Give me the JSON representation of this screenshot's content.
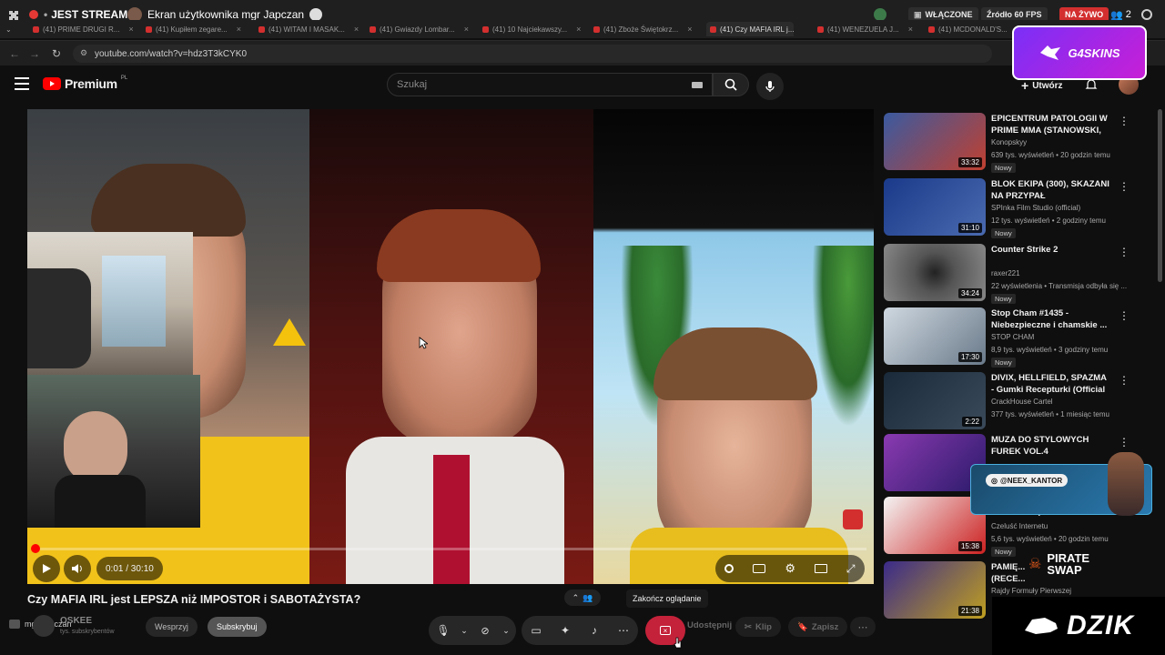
{
  "stream_bar": {
    "stream_label": "JEST STREAM",
    "screen_label": "Ekran użytkownika mgr Japczan",
    "status_on": "WŁĄCZONE",
    "source_fps": "Źródło 60 FPS",
    "live": "NA ŻYWO",
    "viewers": "2"
  },
  "tabs": [
    {
      "label": "(41) PRIME DRUGI R..."
    },
    {
      "label": "(41) Kupiłem zegare..."
    },
    {
      "label": "(41) WITAM I MASAK..."
    },
    {
      "label": "(41) Gwiazdy Lombar..."
    },
    {
      "label": "(41) 10 Najciekawszy..."
    },
    {
      "label": "(41) Zboże Świętokrz..."
    },
    {
      "label": "(41) Czy MAFIA IRL j..."
    },
    {
      "label": "(41) WENEZUELA J..."
    },
    {
      "label": "(41) MCDONALD'S..."
    }
  ],
  "address": {
    "url": "youtube.com/watch?v=hdz3T3kCYK0"
  },
  "youtube": {
    "logo": "Premium",
    "logo_sup": "PL",
    "search_placeholder": "Szukaj",
    "create_label": "Utwórz"
  },
  "overlays": {
    "g4skins": "G4SKINS",
    "neex": "@NEEX_KANTOR",
    "pirate": "PIRATE SWAP",
    "dzik": "DZIK",
    "tooltip": "Zakończ oglądanie"
  },
  "player": {
    "time": "0:01 / 30:10",
    "progress": 0.001
  },
  "video_info": {
    "title": "Czy MAFIA IRL jest LEPSZA niż IMPOSTOR i SABOTAŻYSTA?",
    "host": "mgr Japczan",
    "channel_short": "OSKEE",
    "subs": "tys. subskrybentów",
    "support": "Wesprzyj",
    "subscribe": "Subskrybuj",
    "share": "Udostępnij",
    "clip": "Klip",
    "save": "Zapisz"
  },
  "recommendations": [
    {
      "title": "EPICENTRUM PATOLOGII W PRIME MMA (STANOWSKI, ...",
      "channel": "Konopskyy",
      "meta": "639 tys. wyświetleń • 20 godzin temu",
      "badge": "Nowy",
      "duration": "33:32"
    },
    {
      "title": "BLOK EKIPA (300), SKAZANI NA PRZYPAŁ",
      "channel": "SPInka Film Studio (official)",
      "meta": "12 tys. wyświetleń • 2 godziny temu",
      "badge": "Nowy",
      "duration": "31:10"
    },
    {
      "title": "Counter Strike 2",
      "channel": "raxer221",
      "meta": "22 wyświetlenia • Transmisja odbyła się ...",
      "badge": "Nowy",
      "duration": "34:24"
    },
    {
      "title": "Stop Cham #1435 - Niebezpieczne i chamskie ...",
      "channel": "STOP CHAM",
      "meta": "8,9 tys. wyświetleń • 3 godziny temu",
      "badge": "Nowy",
      "duration": "17:30"
    },
    {
      "title": "DIVIX, HELLFIELD, SPAZMA - Gumki Recepturki (Official ...",
      "channel": "CrackHouse Cartel",
      "meta": "377 tys. wyświetleń • 1 miesiąc temu",
      "badge": "",
      "duration": "2:22"
    },
    {
      "title": "MUZA DO STYLOWYCH FUREK VOL.4",
      "channel": "",
      "meta": "",
      "badge": "",
      "duration": ""
    },
    {
      "title": "Nastolatek (MAKER LAB DUT 2",
      "channel": "Czeluść Internetu",
      "meta": "5,6 tys. wyświetleń • 20 godzin temu",
      "badge": "Nowy",
      "duration": "15:38"
    },
    {
      "title": "PAMIĘ... (RECE...",
      "channel": "Rajdy Formuły Pierwszej",
      "meta": "",
      "badge": "",
      "duration": "21:38"
    }
  ]
}
